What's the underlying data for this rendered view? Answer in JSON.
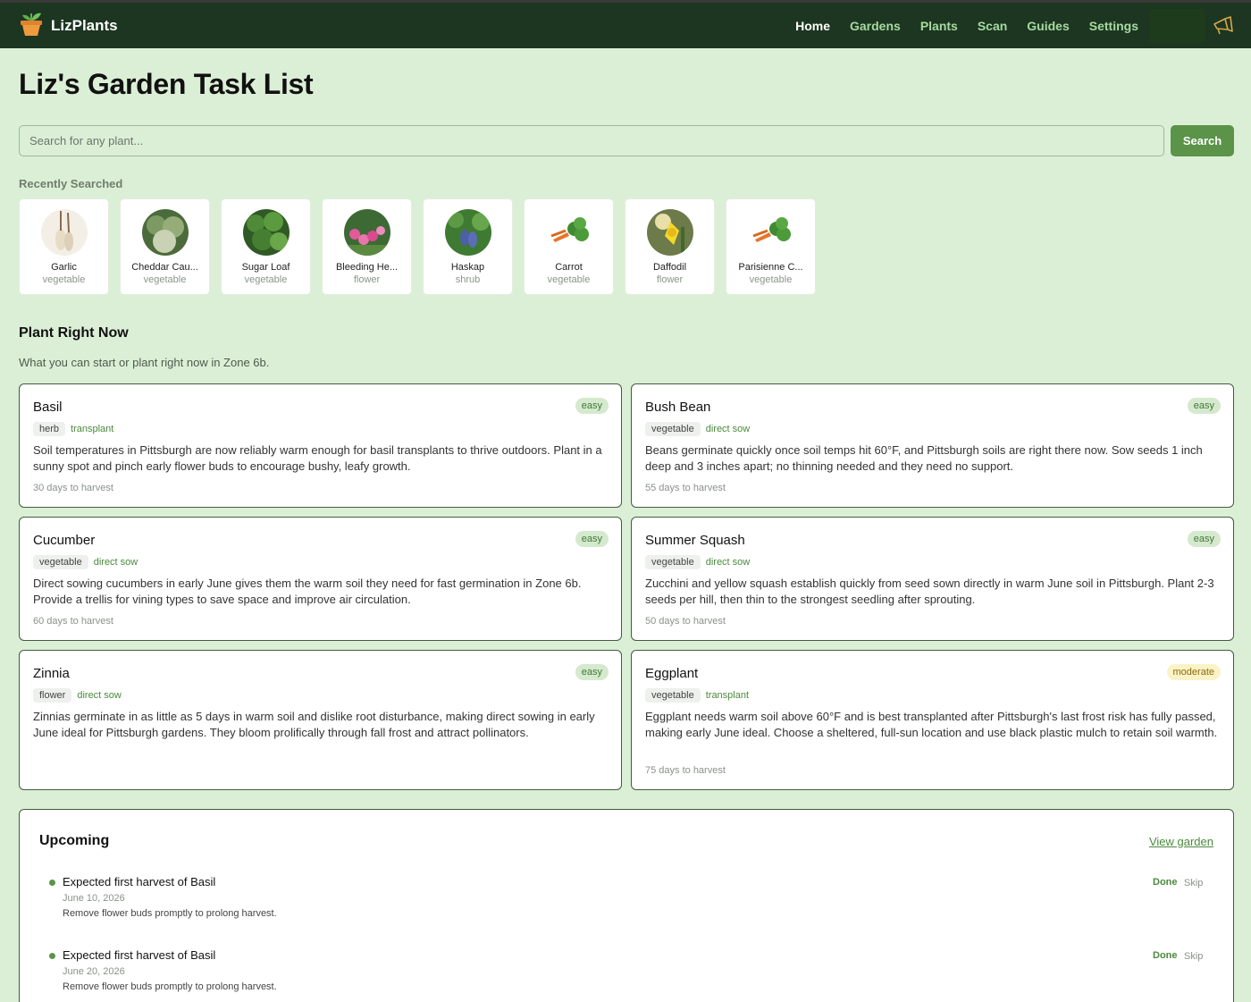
{
  "app": {
    "brand": "LizPlants"
  },
  "nav": {
    "items": [
      "Home",
      "Gardens",
      "Plants",
      "Scan",
      "Guides",
      "Settings"
    ],
    "active": "Home"
  },
  "page": {
    "title": "Liz's Garden Task List"
  },
  "search": {
    "placeholder": "Search for any plant...",
    "button": "Search"
  },
  "recent": {
    "title": "Recently Searched",
    "items": [
      {
        "name": "Garlic",
        "type": "vegetable",
        "icon": "garlic-photo"
      },
      {
        "name": "Cheddar Cau...",
        "type": "vegetable",
        "icon": "cauliflower-photo"
      },
      {
        "name": "Sugar Loaf",
        "type": "vegetable",
        "icon": "chicory-photo"
      },
      {
        "name": "Bleeding He...",
        "type": "flower",
        "icon": "bleeding-heart-photo"
      },
      {
        "name": "Haskap",
        "type": "shrub",
        "icon": "haskap-photo"
      },
      {
        "name": "Carrot",
        "type": "vegetable",
        "icon": "carrot-photo"
      },
      {
        "name": "Daffodil",
        "type": "flower",
        "icon": "daffodil-photo"
      },
      {
        "name": "Parisienne C...",
        "type": "vegetable",
        "icon": "carrot-photo"
      }
    ]
  },
  "plant_now": {
    "title": "Plant Right Now",
    "subtitle": "What you can start or plant right now in Zone 6b.",
    "cards": [
      {
        "name": "Basil",
        "difficulty": "easy",
        "type": "herb",
        "method": "transplant",
        "desc": "Soil temperatures in Pittsburgh are now reliably warm enough for basil transplants to thrive outdoors. Plant in a sunny spot and pinch early flower buds to encourage bushy, leafy growth.",
        "harvest": "30 days to harvest"
      },
      {
        "name": "Bush Bean",
        "difficulty": "easy",
        "type": "vegetable",
        "method": "direct sow",
        "desc": "Beans germinate quickly once soil temps hit 60°F, and Pittsburgh soils are right there now. Sow seeds 1 inch deep and 3 inches apart; no thinning needed and they need no support.",
        "harvest": "55 days to harvest"
      },
      {
        "name": "Cucumber",
        "difficulty": "easy",
        "type": "vegetable",
        "method": "direct sow",
        "desc": "Direct sowing cucumbers in early June gives them the warm soil they need for fast germination in Zone 6b. Provide a trellis for vining types to save space and improve air circulation.",
        "harvest": "60 days to harvest"
      },
      {
        "name": "Summer Squash",
        "difficulty": "easy",
        "type": "vegetable",
        "method": "direct sow",
        "desc": "Zucchini and yellow squash establish quickly from seed sown directly in warm June soil in Pittsburgh. Plant 2-3 seeds per hill, then thin to the strongest seedling after sprouting.",
        "harvest": "50 days to harvest"
      },
      {
        "name": "Zinnia",
        "difficulty": "easy",
        "type": "flower",
        "method": "direct sow",
        "desc": "Zinnias germinate in as little as 5 days in warm soil and dislike root disturbance, making direct sowing in early June ideal for Pittsburgh gardens. They bloom prolifically through fall frost and attract pollinators.",
        "harvest": ""
      },
      {
        "name": "Eggplant",
        "difficulty": "moderate",
        "type": "vegetable",
        "method": "transplant",
        "desc": "Eggplant needs warm soil above 60°F and is best transplanted after Pittsburgh's last frost risk has fully passed, making early June ideal. Choose a sheltered, full-sun location and use black plastic mulch to retain soil warmth.",
        "harvest": "75 days to harvest"
      }
    ]
  },
  "upcoming": {
    "title": "Upcoming",
    "link": "View garden",
    "done_label": "Done",
    "skip_label": "Skip",
    "tasks": [
      {
        "title": "Expected first harvest of Basil",
        "date": "June 10, 2026",
        "note": "Remove flower buds promptly to prolong harvest."
      },
      {
        "title": "Expected first harvest of Basil",
        "date": "June 20, 2026",
        "note": "Remove flower buds promptly to prolong harvest."
      }
    ]
  },
  "colors": {
    "header": "#1c3621",
    "background": "#dbefd6",
    "accent": "#5b9349",
    "nav_link": "#a8d9a0"
  }
}
